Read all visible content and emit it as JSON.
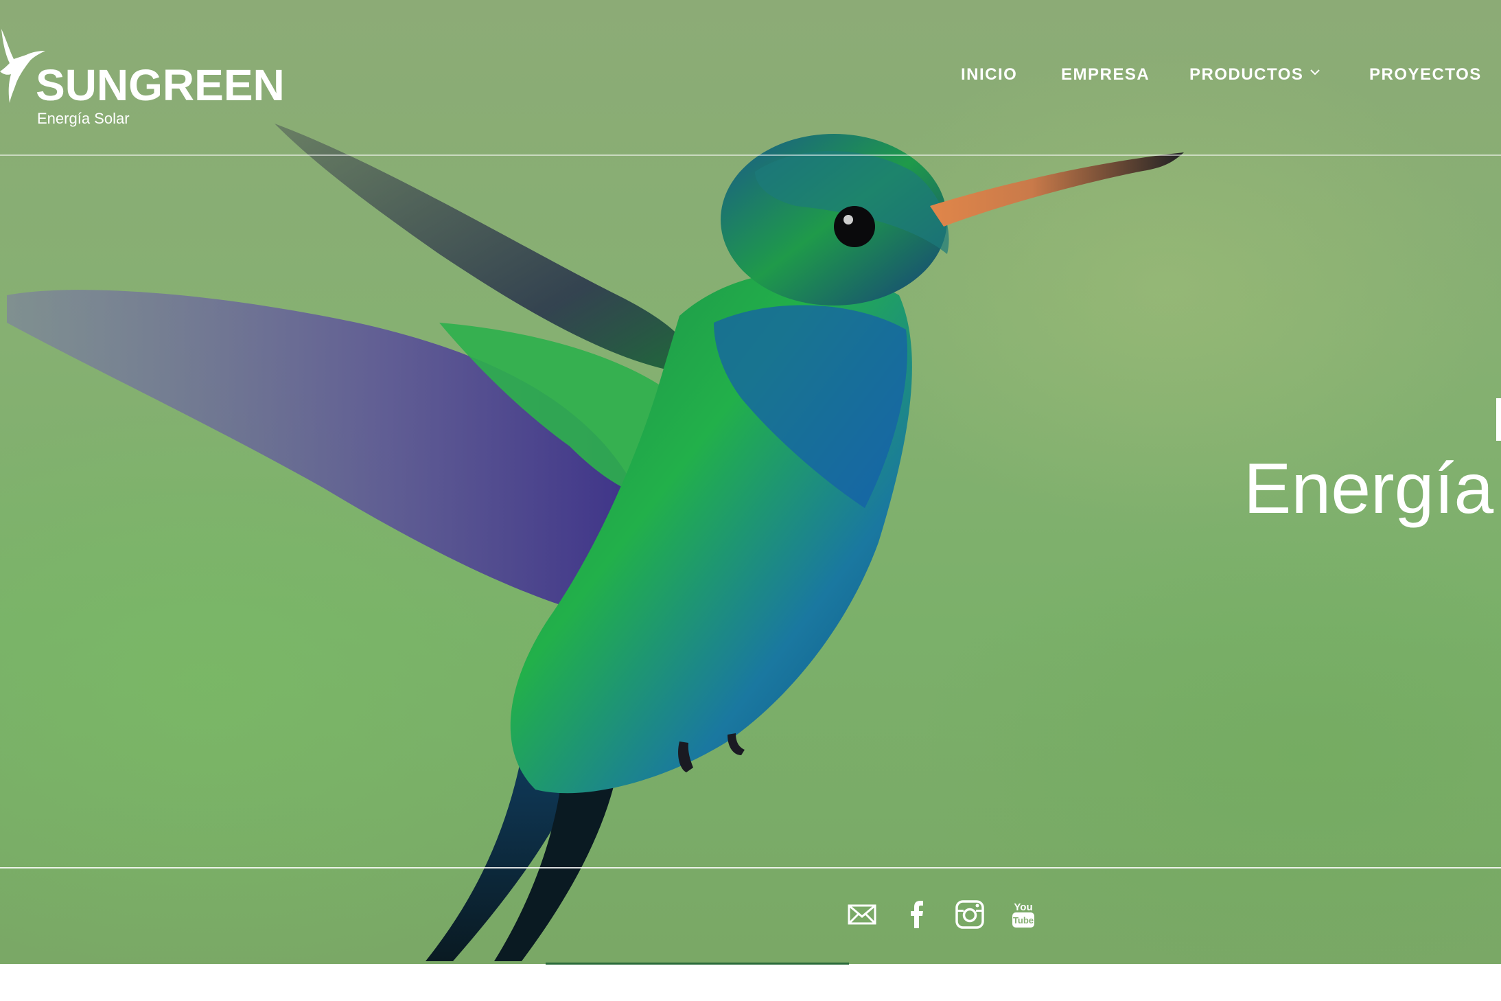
{
  "brand": {
    "name": "SUNGREEN",
    "tagline": "Energía Solar"
  },
  "nav": {
    "items": [
      {
        "label": "INICIO"
      },
      {
        "label": "EMPRESA"
      },
      {
        "label": "PRODUCTOS",
        "has_dropdown": true
      },
      {
        "label": "PROYECTOS"
      }
    ]
  },
  "hero": {
    "title": "Energía"
  },
  "social": {
    "icons": [
      "mail-icon",
      "facebook-icon",
      "instagram-icon",
      "youtube-icon"
    ],
    "youtube_label": "You Tube"
  },
  "colors": {
    "text": "#ffffff",
    "background_green": "#86b072"
  }
}
